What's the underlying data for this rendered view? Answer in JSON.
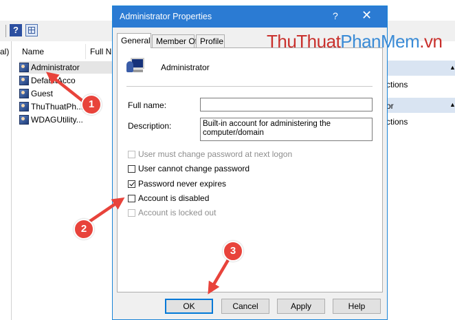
{
  "mmc": {
    "left_fragment": "al)",
    "columns": [
      "Name",
      "Full N"
    ],
    "users": [
      {
        "name": "Administrator",
        "selected": true
      },
      {
        "name": "DefaultAcco",
        "selected": false
      },
      {
        "name": "Guest",
        "selected": false
      },
      {
        "name": "ThuThuatPh...",
        "selected": false
      },
      {
        "name": "WDAGUtility...",
        "selected": false
      }
    ],
    "actions": [
      "ctions",
      "or",
      "ctions"
    ]
  },
  "watermark": {
    "part1": "ThuThuat",
    "part2": "PhanMem",
    "part3": ".vn"
  },
  "dialog": {
    "title": "Administrator Properties",
    "help_glyph": "?",
    "close_glyph": "✕",
    "tabs": [
      "General",
      "Member Of",
      "Profile"
    ],
    "active_tab": "General",
    "username": "Administrator",
    "full_name_label": "Full name:",
    "full_name_value": "",
    "description_label": "Description:",
    "description_value": "Built-in account for administering the computer/domain",
    "checkboxes": [
      {
        "label": "User must change password at next logon",
        "checked": false,
        "enabled": false
      },
      {
        "label": "User cannot change password",
        "checked": false,
        "enabled": true
      },
      {
        "label": "Password never expires",
        "checked": true,
        "enabled": true
      },
      {
        "label": "Account is disabled",
        "checked": false,
        "enabled": true
      },
      {
        "label": "Account is locked out",
        "checked": false,
        "enabled": false
      }
    ],
    "buttons": {
      "ok": "OK",
      "cancel": "Cancel",
      "apply": "Apply",
      "help": "Help"
    }
  },
  "callouts": [
    "1",
    "2",
    "3"
  ],
  "colors": {
    "accent": "#2b7bd3",
    "callout": "#e8433b"
  }
}
